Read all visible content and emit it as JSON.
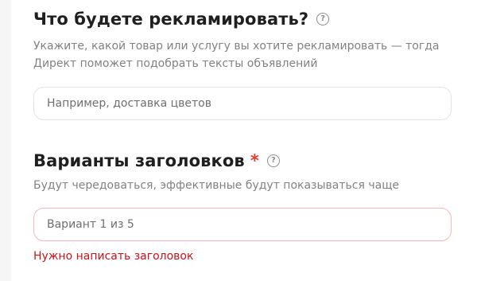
{
  "advert_section": {
    "title": "Что будете рекламировать?",
    "help_glyph": "?",
    "description_line1": "Укажите, какой товар или услугу вы хотите рекламировать — тогда",
    "description_line2": "Директ поможет подобрать тексты объявлений",
    "input_placeholder": "Например, доставка цветов",
    "input_value": ""
  },
  "headlines_section": {
    "title": "Варианты заголовков",
    "required_mark": "*",
    "help_glyph": "?",
    "description": "Будут чередоваться, эффективные будут показываться чаще",
    "input_placeholder": "Вариант 1 из 5",
    "input_value": "",
    "error_message": "Нужно написать заголовок"
  },
  "colors": {
    "error": "#c8141b",
    "required_star": "#e23b2e",
    "error_border": "#f4b9bd"
  },
  "icons": {
    "help": "question-circle-icon"
  }
}
